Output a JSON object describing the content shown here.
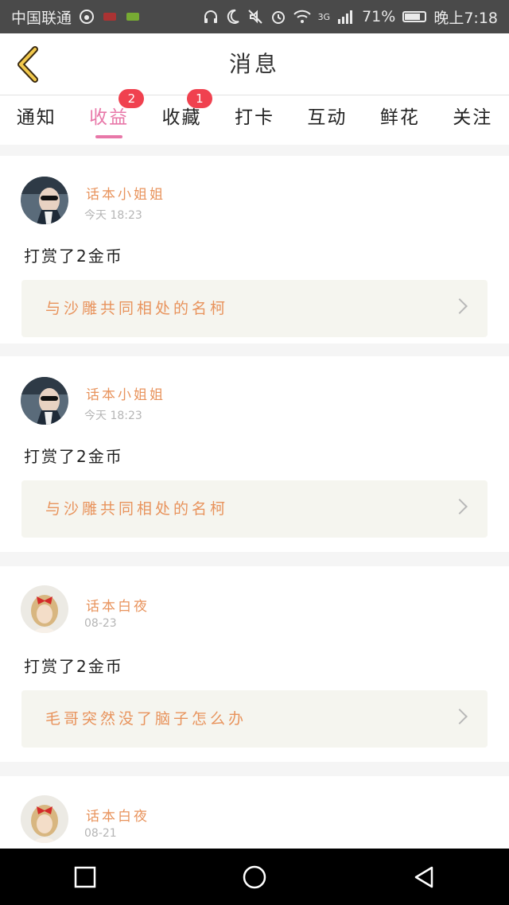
{
  "status_bar": {
    "carrier": "中国联通",
    "network": "3G",
    "battery": "71%",
    "time": "晚上7:18",
    "icons": [
      "weibo-icon",
      "app-icon",
      "app-icon",
      "headphones-icon",
      "moon-icon",
      "mute-icon",
      "alarm-icon",
      "wifi-icon",
      "signal-icon",
      "battery-icon"
    ]
  },
  "header": {
    "title": "消息",
    "back_icon": "chevron-left-icon"
  },
  "tabs": [
    {
      "label": "通知",
      "active": false,
      "badge": ""
    },
    {
      "label": "收益",
      "active": true,
      "badge": "2"
    },
    {
      "label": "收藏",
      "active": false,
      "badge": "1"
    },
    {
      "label": "打卡",
      "active": false,
      "badge": ""
    },
    {
      "label": "互动",
      "active": false,
      "badge": ""
    },
    {
      "label": "鲜花",
      "active": false,
      "badge": ""
    },
    {
      "label": "关注",
      "active": false,
      "badge": ""
    }
  ],
  "messages": [
    {
      "user": "话本小姐姐",
      "time": "今天 18:23",
      "action": "打赏了2金币",
      "story": "与沙雕共同相处的名柯",
      "avatar": "sunglasses-avatar"
    },
    {
      "user": "话本小姐姐",
      "time": "今天 18:23",
      "action": "打赏了2金币",
      "story": "与沙雕共同相处的名柯",
      "avatar": "sunglasses-avatar"
    },
    {
      "user": "话本白夜",
      "time": "08-23",
      "action": "打赏了2金币",
      "story": "毛哥突然没了脑子怎么办",
      "avatar": "girl-bow-avatar"
    },
    {
      "user": "话本白夜",
      "time": "08-21",
      "action": "",
      "story": "",
      "avatar": "girl-bow-avatar"
    }
  ],
  "nav_bar": {
    "icons": [
      "recent-apps-icon",
      "home-icon",
      "back-icon"
    ]
  },
  "colors": {
    "accent": "#e877a8",
    "badge": "#f0414f",
    "username": "#e8935c"
  }
}
